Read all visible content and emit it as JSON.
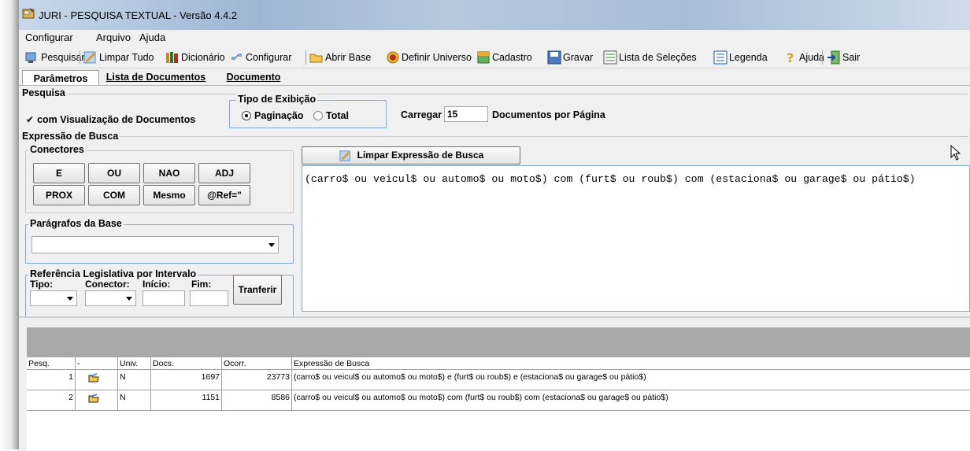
{
  "window": {
    "title": "JURI - PESQUISA TEXTUAL - Versão 4.4.2"
  },
  "menu": [
    "Configurar",
    "Arquivo",
    "Ajuda"
  ],
  "toolbar": {
    "pesquisar": "Pesquisar",
    "limpar_tudo": "Limpar Tudo",
    "dicionario": "Dicionário",
    "configurar": "Configurar",
    "abrir_base": "Abrir Base",
    "definir_universo": "Definir Universo",
    "cadastro": "Cadastro",
    "gravar": "Gravar",
    "lista_selecoes": "Lista de Seleções",
    "legenda": "Legenda",
    "ajuda": "Ajuda",
    "sair": "Sair"
  },
  "tabs": {
    "parametros": "Parâmetros",
    "lista_documentos": "Lista de Documentos",
    "documento": "Documento"
  },
  "pesquisa": {
    "title": "Pesquisa",
    "visualizacao_label": "com Visualização de Documentos",
    "tipo_exibicao_title": "Tipo de Exibição",
    "paginacao_label": "Paginação",
    "total_label": "Total",
    "carregar_label": "Carregar",
    "carregar_value": "15",
    "documentos_por_pagina": "Documentos por Página"
  },
  "expressao": {
    "title": "Expressão de Busca",
    "conectores_title": "Conectores",
    "conectores": [
      "E",
      "OU",
      "NAO",
      "ADJ",
      "PROX",
      "COM",
      "Mesmo",
      "@Ref=\""
    ],
    "paragrafos_title": "Parágrafos da Base",
    "referencia_title": "Referência Legislativa por Intervalo",
    "tipo_label": "Tipo:",
    "conector_label": "Conector:",
    "inicio_label": "Início:",
    "fim_label": "Fim:",
    "transferir": "Tranferir",
    "limpar_expressao": "Limpar Expressão de Busca",
    "query_text": "(carro$ ou veicul$ ou automo$ ou moto$) com (furt$ ou roub$) com (estaciona$ ou garage$ ou pátio$)"
  },
  "grid": {
    "headers": [
      "Pesq.",
      "-",
      "Univ.",
      "Docs.",
      "Ocorr.",
      "Expressão de Busca"
    ],
    "rows": [
      {
        "pesq": "1",
        "univ": "N",
        "docs": "1697",
        "ocorr": "23773",
        "expr": "(carro$ ou veicul$ ou automo$ ou moto$) e (furt$ ou roub$) e (estaciona$ ou garage$ ou pátio$)"
      },
      {
        "pesq": "2",
        "univ": "N",
        "docs": "1151",
        "ocorr": "8586",
        "expr": "(carro$ ou veicul$ ou automo$ ou moto$) com (furt$ ou roub$) com (estaciona$ ou garage$ ou pátio$)"
      }
    ]
  }
}
